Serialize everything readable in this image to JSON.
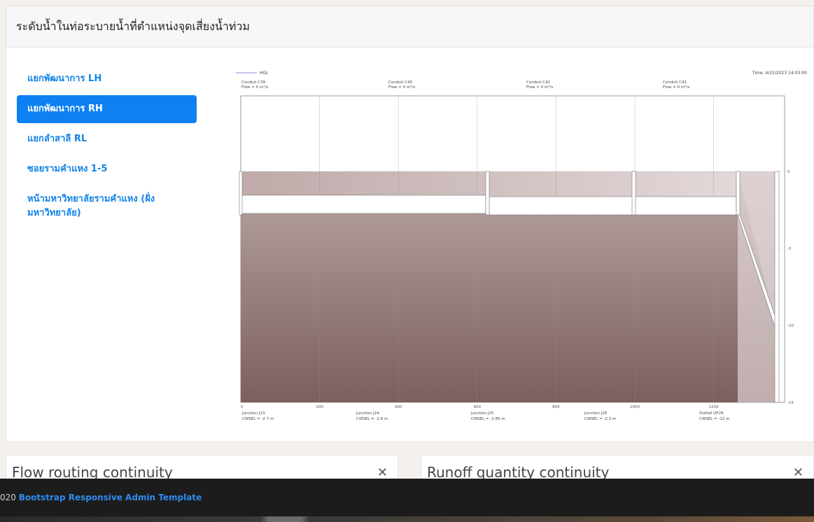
{
  "card": {
    "title": "ระดับน้ำในท่อระบายน้ำที่ตำแหน่งจุดเสี่ยงน้ำท่วม"
  },
  "nav": {
    "items": [
      {
        "label": "แยกพัฒนาการ LH",
        "active": false
      },
      {
        "label": "แยกพัฒนาการ RH",
        "active": true
      },
      {
        "label": "แยกลำสาลี RL",
        "active": false
      },
      {
        "label": "ซอยรามคำแหง 1-5",
        "active": false
      },
      {
        "label": "หน้ามหาวิทยาลัยรามคำแหง (ฝั่งมหาวิทยาลัย)",
        "active": false
      }
    ]
  },
  "chart_data": {
    "type": "area",
    "legend": "HGL",
    "timestamp": "Time: 4/25/2023 14:03:00",
    "conduits": [
      {
        "name": "Conduit C39",
        "flow": "Flow = 0 m³/s"
      },
      {
        "name": "Conduit C40",
        "flow": "Flow = 0 m³/s"
      },
      {
        "name": "Conduit C41",
        "flow": "Flow = 0 m³/s"
      },
      {
        "name": "Conduit C42",
        "flow": "Flow = 0 m³/s"
      }
    ],
    "junctions": [
      {
        "name": "Junction J23",
        "cwsel": "CWSEL = -2.7 m"
      },
      {
        "name": "Junction J24",
        "cwsel": "CWSEL = -2.8 m"
      },
      {
        "name": "Junction J25",
        "cwsel": "CWSEL = -2.85 m"
      },
      {
        "name": "Junction J26",
        "cwsel": "CWSEL = -2.3 m"
      },
      {
        "name": "Outfall OF26",
        "cwsel": "CWSEL = -12 m"
      }
    ],
    "x_ticks": [
      0,
      200,
      400,
      600,
      800,
      1000,
      1200
    ],
    "y_ticks": [
      0,
      -5,
      -10,
      -15
    ],
    "xlim": [
      0,
      1380
    ],
    "ylim": [
      -15,
      5
    ]
  },
  "panels": {
    "left_title": "Flow routing continuity",
    "right_title": "Runoff quantity continuity",
    "close_icon": "✕"
  },
  "footer": {
    "prefix": "020",
    "link": "Bootstrap Responsive Admin Template"
  }
}
